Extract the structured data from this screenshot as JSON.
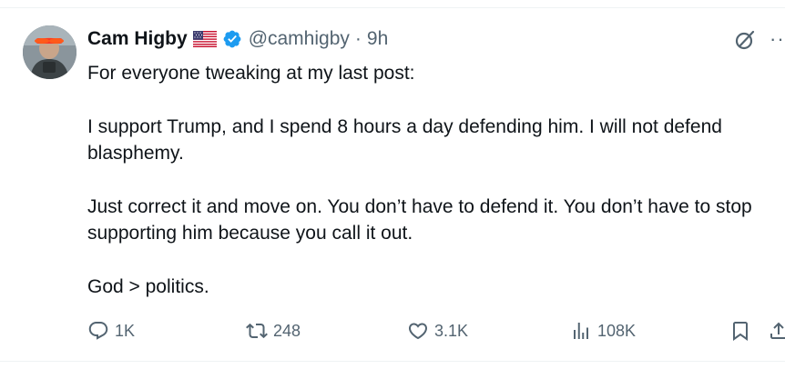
{
  "post": {
    "author": {
      "name": "Cam Higby",
      "handle": "@camhigby",
      "separator": "·",
      "time": "9h",
      "flag_icon": "us-flag-icon",
      "verified_icon": "verified-badge-icon",
      "verified_color": "#1d9bf0"
    },
    "text": [
      "For everyone tweaking at my last post:",
      "I support Trump, and I spend 8 hours a day defending him. I will not defend blasphemy.",
      "Just correct it and move on. You don’t have to defend it. You don’t have to stop supporting him because you call it out.",
      "God > politics."
    ],
    "actions": {
      "replies": "1K",
      "reposts": "248",
      "likes": "3.1K",
      "views": "108K"
    },
    "icons": {
      "grok": "grok-icon",
      "more": "more-dots-icon",
      "reply": "reply-icon",
      "repost": "repost-icon",
      "like": "heart-icon",
      "views": "views-chart-icon",
      "bookmark": "bookmark-icon",
      "share": "share-icon"
    },
    "colors": {
      "text": "#0f1419",
      "secondary": "#536471"
    }
  }
}
